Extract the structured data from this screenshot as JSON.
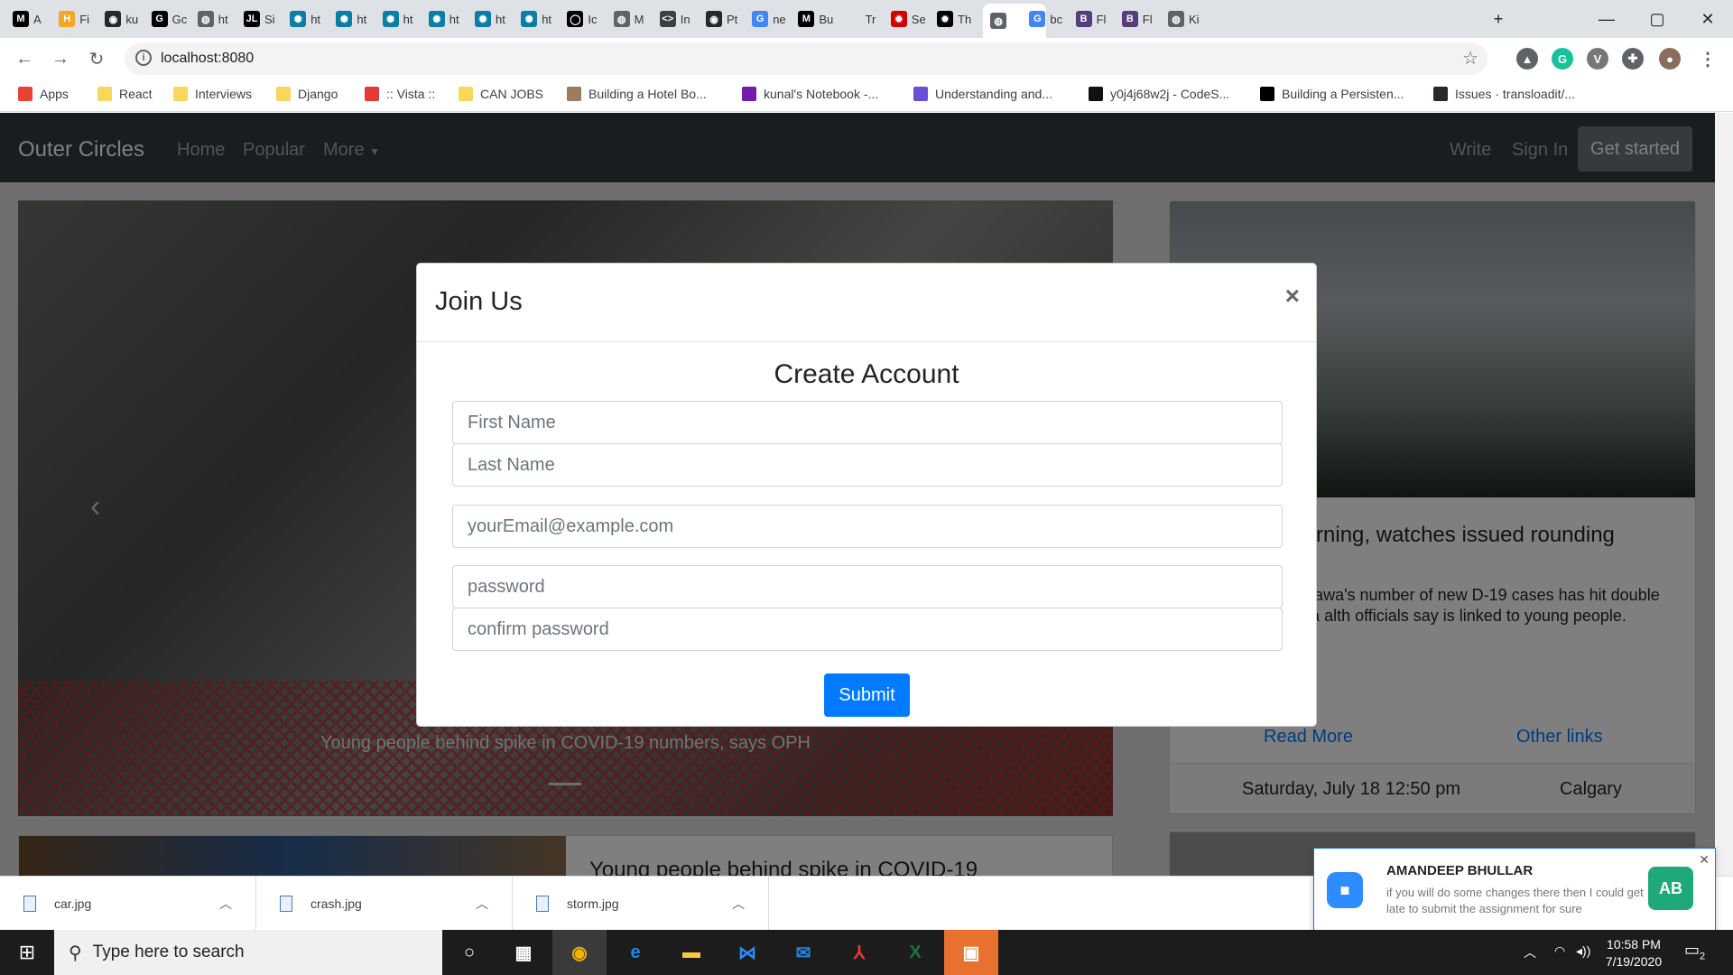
{
  "browser": {
    "tabs": [
      {
        "label": "A",
        "icon": "medium-icon",
        "color": "#000000",
        "glyph": "M"
      },
      {
        "label": "Fi",
        "icon": "h-icon",
        "color": "#f5a623",
        "glyph": "H"
      },
      {
        "label": "ku",
        "icon": "github-icon",
        "color": "#24292e",
        "glyph": "◉"
      },
      {
        "label": "Gc",
        "icon": "g-icon",
        "color": "#000000",
        "glyph": "G"
      },
      {
        "label": "ht",
        "icon": "globe-icon",
        "color": "#5f6368",
        "glyph": "◍"
      },
      {
        "label": "Si",
        "icon": "jl-icon",
        "color": "#000000",
        "glyph": "JL"
      },
      {
        "label": "ht",
        "icon": "react-icon",
        "color": "#0a7ea4",
        "glyph": "✺"
      },
      {
        "label": "ht",
        "icon": "react-icon",
        "color": "#0a7ea4",
        "glyph": "✺"
      },
      {
        "label": "ht",
        "icon": "react-icon",
        "color": "#0a7ea4",
        "glyph": "✺"
      },
      {
        "label": "ht",
        "icon": "react-icon",
        "color": "#0a7ea4",
        "glyph": "✺"
      },
      {
        "label": "ht",
        "icon": "react-icon",
        "color": "#0a7ea4",
        "glyph": "✺"
      },
      {
        "label": "ht",
        "icon": "react-icon",
        "color": "#0a7ea4",
        "glyph": "✺"
      },
      {
        "label": "Ic",
        "icon": "circle-icon",
        "color": "#000000",
        "glyph": "◯"
      },
      {
        "label": "M",
        "icon": "globe-icon",
        "color": "#5f6368",
        "glyph": "◍"
      },
      {
        "label": "In",
        "icon": "code-icon",
        "color": "#3c4043",
        "glyph": "<>"
      },
      {
        "label": "Pt",
        "icon": "github-icon",
        "color": "#24292e",
        "glyph": "◉"
      },
      {
        "label": "ne",
        "icon": "google-icon",
        "color": "#4285f4",
        "glyph": "G"
      },
      {
        "label": "Bu",
        "icon": "medium-icon",
        "color": "#000000",
        "glyph": "M"
      },
      {
        "label": "Tr",
        "icon": "blank-icon",
        "color": "#dee1e6",
        "glyph": ""
      },
      {
        "label": "Se",
        "icon": "cbc-icon",
        "color": "#d50000",
        "glyph": "✹"
      },
      {
        "label": "Th",
        "icon": "cbc-icon",
        "color": "#000000",
        "glyph": "✹"
      },
      {
        "label": "",
        "icon": "globe-icon",
        "color": "#5f6368",
        "glyph": "◍"
      },
      {
        "label": "bc",
        "icon": "google-icon",
        "color": "#4285f4",
        "glyph": "G"
      },
      {
        "label": "Fl",
        "icon": "bootstrap-icon",
        "color": "#563d7c",
        "glyph": "B"
      },
      {
        "label": "Fl",
        "icon": "bootstrap-icon",
        "color": "#563d7c",
        "glyph": "B"
      },
      {
        "label": "Ki",
        "icon": "globe-icon",
        "color": "#5f6368",
        "glyph": "◍"
      }
    ],
    "url": "localhost:8080",
    "bookmarks": [
      {
        "label": "Apps",
        "color": "#ea4335"
      },
      {
        "label": "React",
        "color": "#f9d65c"
      },
      {
        "label": "Interviews",
        "color": "#f9d65c"
      },
      {
        "label": "Django",
        "color": "#f9d65c"
      },
      {
        "label": ":: Vista ::",
        "color": "#e53935"
      },
      {
        "label": "CAN JOBS",
        "color": "#f9d65c"
      },
      {
        "label": "Building a Hotel Bo...",
        "color": "#9e7b5b"
      },
      {
        "label": "kunal's Notebook -...",
        "color": "#7719aa"
      },
      {
        "label": "Understanding and...",
        "color": "#6a4fd8"
      },
      {
        "label": "y0j4j68w2j - CodeS...",
        "color": "#111111"
      },
      {
        "label": "Building a Persisten...",
        "color": "#000000"
      },
      {
        "label": "Issues · transloadit/...",
        "color": "#24292e"
      }
    ]
  },
  "site": {
    "brand": "Outer Circles",
    "nav": {
      "home": "Home",
      "popular": "Popular",
      "more": "More"
    },
    "right": {
      "write": "Write",
      "signin": "Sign In",
      "started": "Get started"
    },
    "carousel_caption": "Young people behind spike in COVID-19 numbers, says OPH",
    "card": {
      "title": "derstorm warning, watches issued rounding Calgary",
      "text": "day in a row, Ottawa's number of new D-19 cases has hit double digits — part of a alth officials say is linked to young people.",
      "read_more": "Read More",
      "other_links": "Other links",
      "date": "Saturday, July 18 12:50 pm",
      "city": "Calgary"
    },
    "bottom_card_title": "Young people behind spike in COVID-19"
  },
  "modal": {
    "title": "Join Us",
    "close": "×",
    "heading": "Create Account",
    "first_name": "First Name",
    "last_name": "Last Name",
    "email": "yourEmail@example.com",
    "password": "password",
    "confirm": "confirm password",
    "submit": "Submit"
  },
  "downloads": [
    {
      "name": "car.jpg"
    },
    {
      "name": "crash.jpg"
    },
    {
      "name": "storm.jpg"
    }
  ],
  "notification": {
    "name": "AMANDEEP BHULLAR",
    "message": "if you will do some changes there then I could get late to submit the assignment for sure",
    "avatar": "AB"
  },
  "taskbar": {
    "search_placeholder": "Type here to search",
    "time": "10:58 PM",
    "date": "7/19/2020",
    "notif_count": "2"
  }
}
